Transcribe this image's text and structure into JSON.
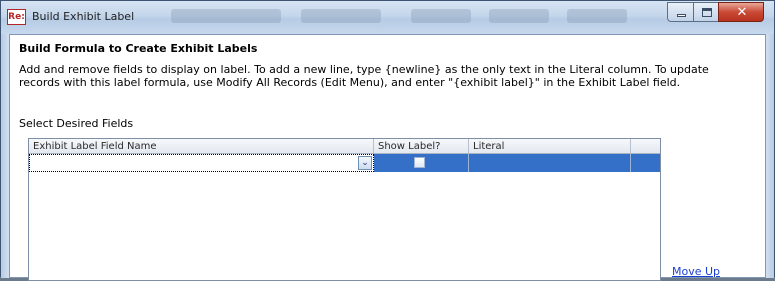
{
  "window": {
    "app_icon_text": "Re:",
    "title": "Build Exhibit Label",
    "controls": {
      "minimize": "minimize",
      "maximize": "maximize",
      "close": "✕"
    }
  },
  "dialog": {
    "heading": "Build Formula to Create Exhibit Labels",
    "description": "Add and remove fields to display on label.  To add a new line, type {newline} as the only text in the Literal column.  To update\nrecords with this label formula, use Modify All Records (Edit Menu), and enter \"{exhibit label}\" in the Exhibit Label field.",
    "section_label": "Select Desired Fields"
  },
  "grid": {
    "columns": [
      {
        "label": "Exhibit Label Field Name"
      },
      {
        "label": "Show Label?"
      },
      {
        "label": "Literal"
      }
    ],
    "rows": [
      {
        "field_name": "",
        "show_label": false,
        "literal": "",
        "selected": true
      }
    ]
  },
  "actions": {
    "move_up": "Move Up"
  },
  "colors": {
    "selection": "#3470c7",
    "link": "#1a3fd1",
    "title_bar": "#c4d6eb"
  },
  "icons": {
    "dropdown": "chevron-down-icon"
  }
}
